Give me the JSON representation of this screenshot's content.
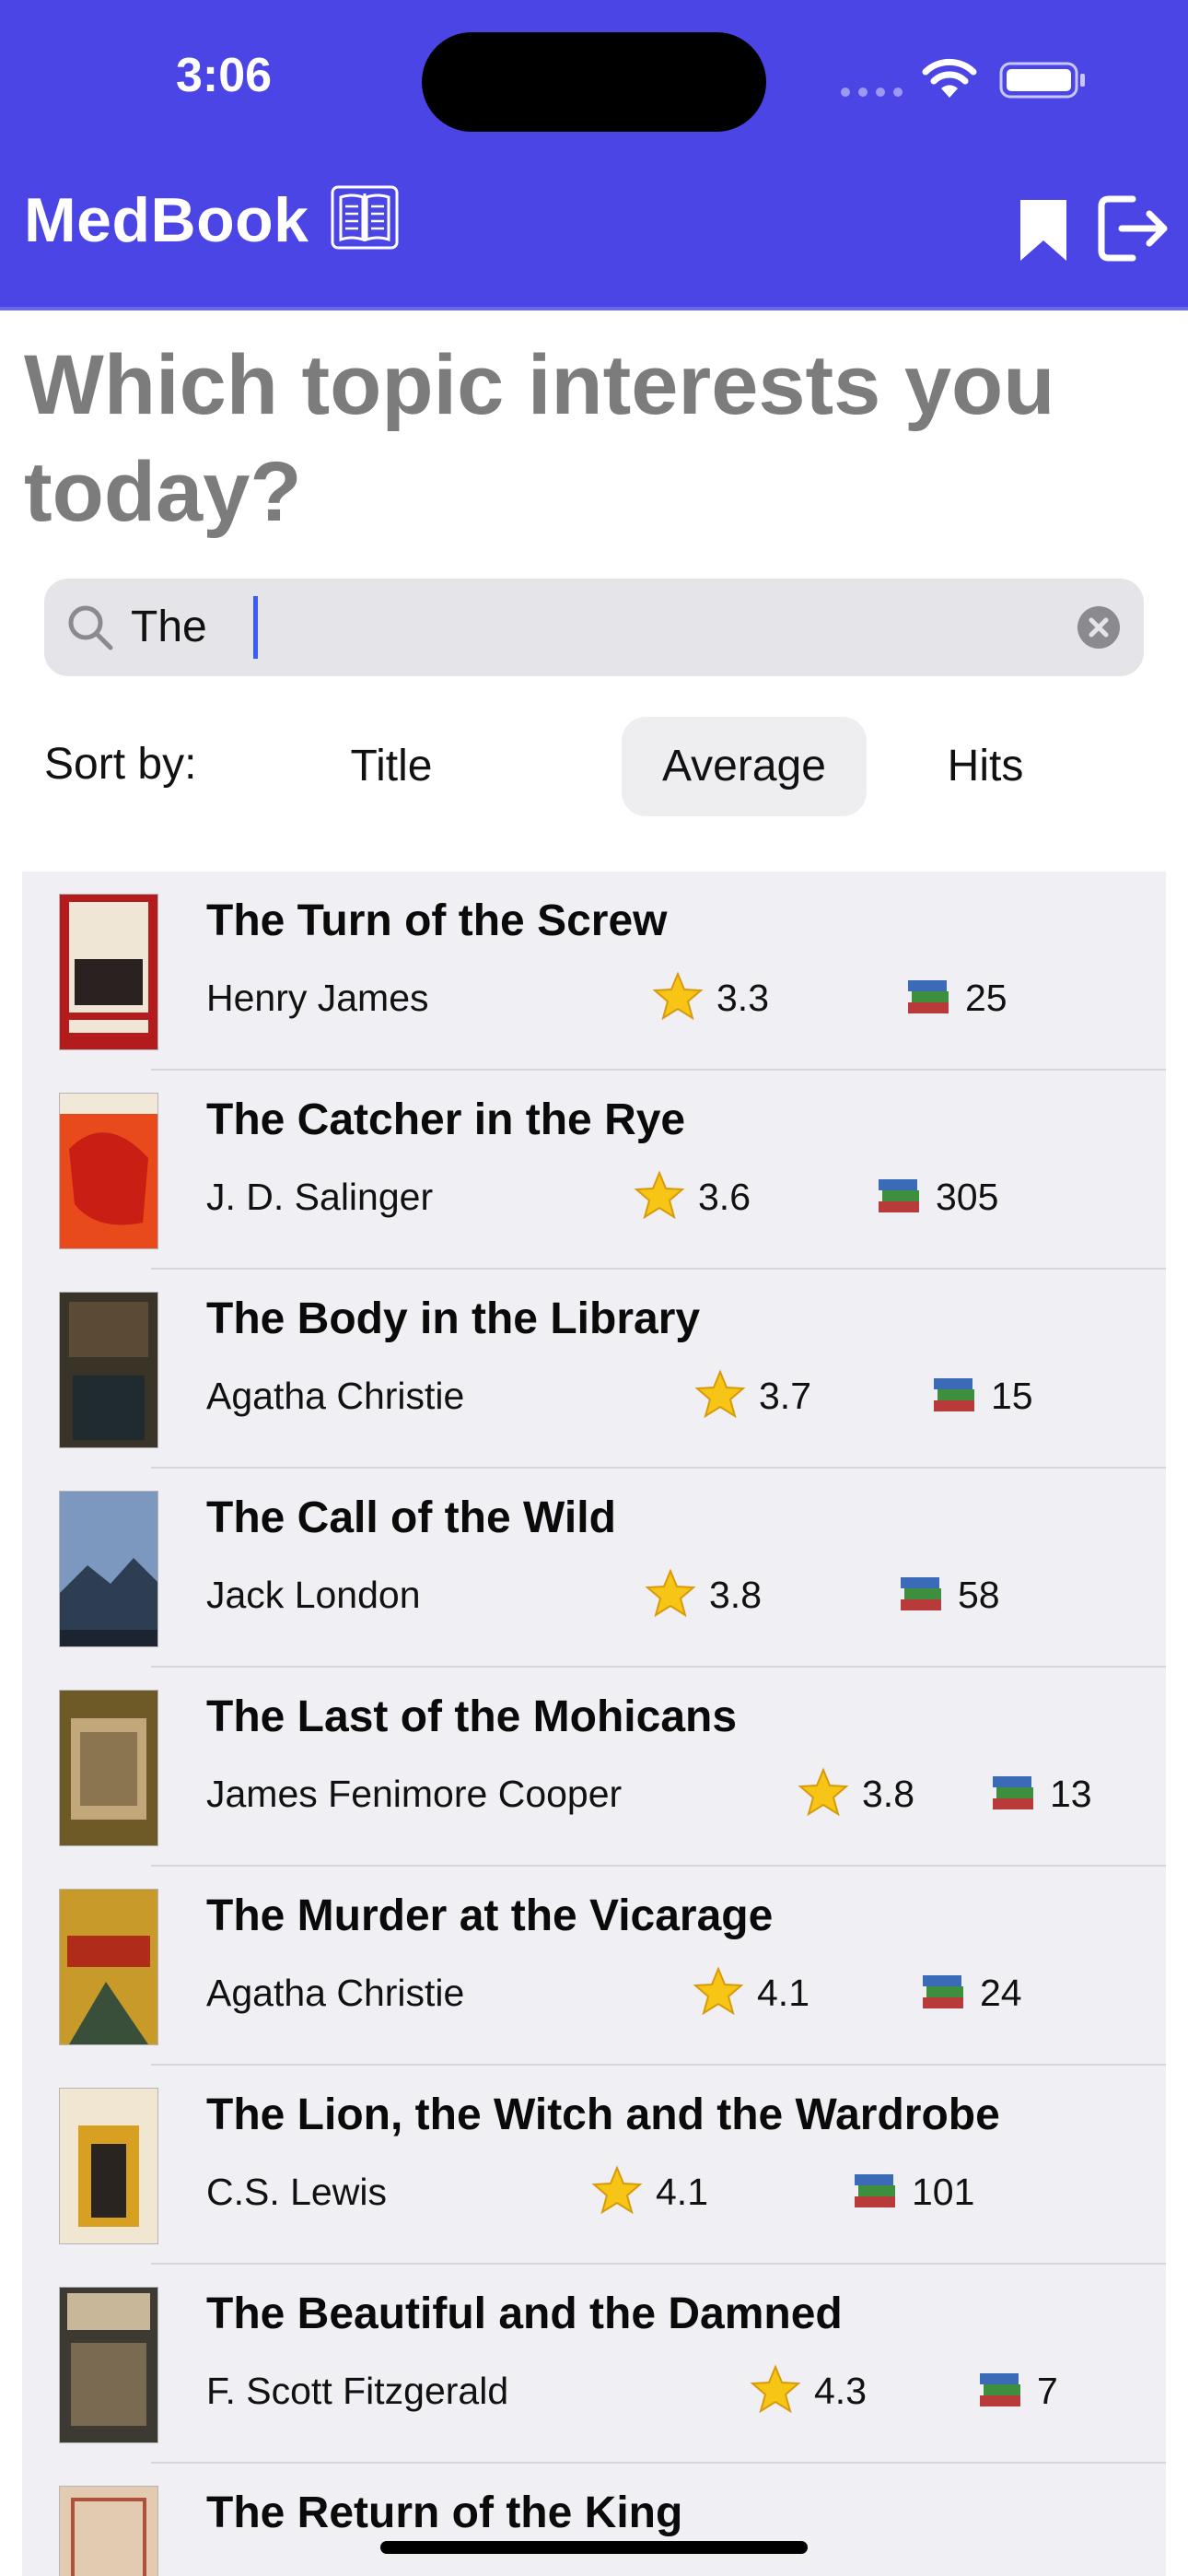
{
  "status": {
    "time": "3:06"
  },
  "header": {
    "title": "MedBook",
    "icons": [
      "book-icon",
      "bookmark-icon",
      "logout-icon"
    ]
  },
  "prompt": {
    "heading": "Which topic interests you today?"
  },
  "search": {
    "value": "The"
  },
  "sort": {
    "label": "Sort by:",
    "options": [
      "Title",
      "Average",
      "Hits"
    ],
    "selected": "Average"
  },
  "books": [
    {
      "title": "The Turn of the Screw",
      "author": "Henry James",
      "rating": "3.3",
      "hits": "25"
    },
    {
      "title": "The Catcher in the Rye",
      "author": "J. D. Salinger",
      "rating": "3.6",
      "hits": "305"
    },
    {
      "title": "The Body in the Library",
      "author": "Agatha Christie",
      "rating": "3.7",
      "hits": "15"
    },
    {
      "title": "The Call of the Wild",
      "author": "Jack London",
      "rating": "3.8",
      "hits": "58"
    },
    {
      "title": "The Last of the Mohicans",
      "author": "James Fenimore Cooper",
      "rating": "3.8",
      "hits": "13"
    },
    {
      "title": "The Murder at the Vicarage",
      "author": "Agatha Christie",
      "rating": "4.1",
      "hits": "24"
    },
    {
      "title": "The Lion, the Witch and the Wardrobe",
      "author": "C.S. Lewis",
      "rating": "4.1",
      "hits": "101"
    },
    {
      "title": "The Beautiful and the Damned",
      "author": "F. Scott Fitzgerald",
      "rating": "4.3",
      "hits": "7"
    },
    {
      "title": "The Return of the King",
      "author": "",
      "rating": "",
      "hits": ""
    }
  ],
  "colors": {
    "header": "#4c45e6",
    "list_background": "#f0f0f4",
    "heading_text": "#7c7c7c",
    "caret": "#3c5bff"
  }
}
